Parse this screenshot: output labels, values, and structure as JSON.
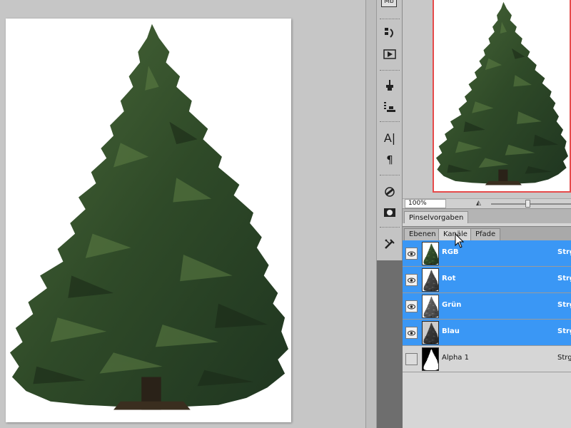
{
  "navigator": {
    "zoom_value": "100%"
  },
  "brush_panel": {
    "tab_label": "Pinselvorgaben"
  },
  "channels_panel": {
    "tabs": [
      {
        "label": "Ebenen"
      },
      {
        "label": "Kanäle"
      },
      {
        "label": "Pfade"
      }
    ],
    "active_tab": "Kanäle",
    "rows": [
      {
        "name": "RGB",
        "shortcut": "Strg",
        "visible": true,
        "selected": true
      },
      {
        "name": "Rot",
        "shortcut": "Strg",
        "visible": true,
        "selected": true
      },
      {
        "name": "Grün",
        "shortcut": "Strg",
        "visible": true,
        "selected": true
      },
      {
        "name": "Blau",
        "shortcut": "Strg",
        "visible": true,
        "selected": true
      },
      {
        "name": "Alpha 1",
        "shortcut": "Strg",
        "visible": false,
        "selected": false
      }
    ]
  },
  "toolstrip": {
    "top_label": "Mb",
    "icons": [
      "history-icon",
      "actions-play-icon",
      "clone-source-icon",
      "tool-presets-icon",
      "character-icon",
      "paragraph-icon",
      "adjustments-icon",
      "masks-icon",
      "tools-icon"
    ]
  },
  "colors": {
    "selection_blue": "#3a97f5",
    "navigator_frame": "#e64a4a",
    "panel_bg": "#d6d6d6"
  }
}
